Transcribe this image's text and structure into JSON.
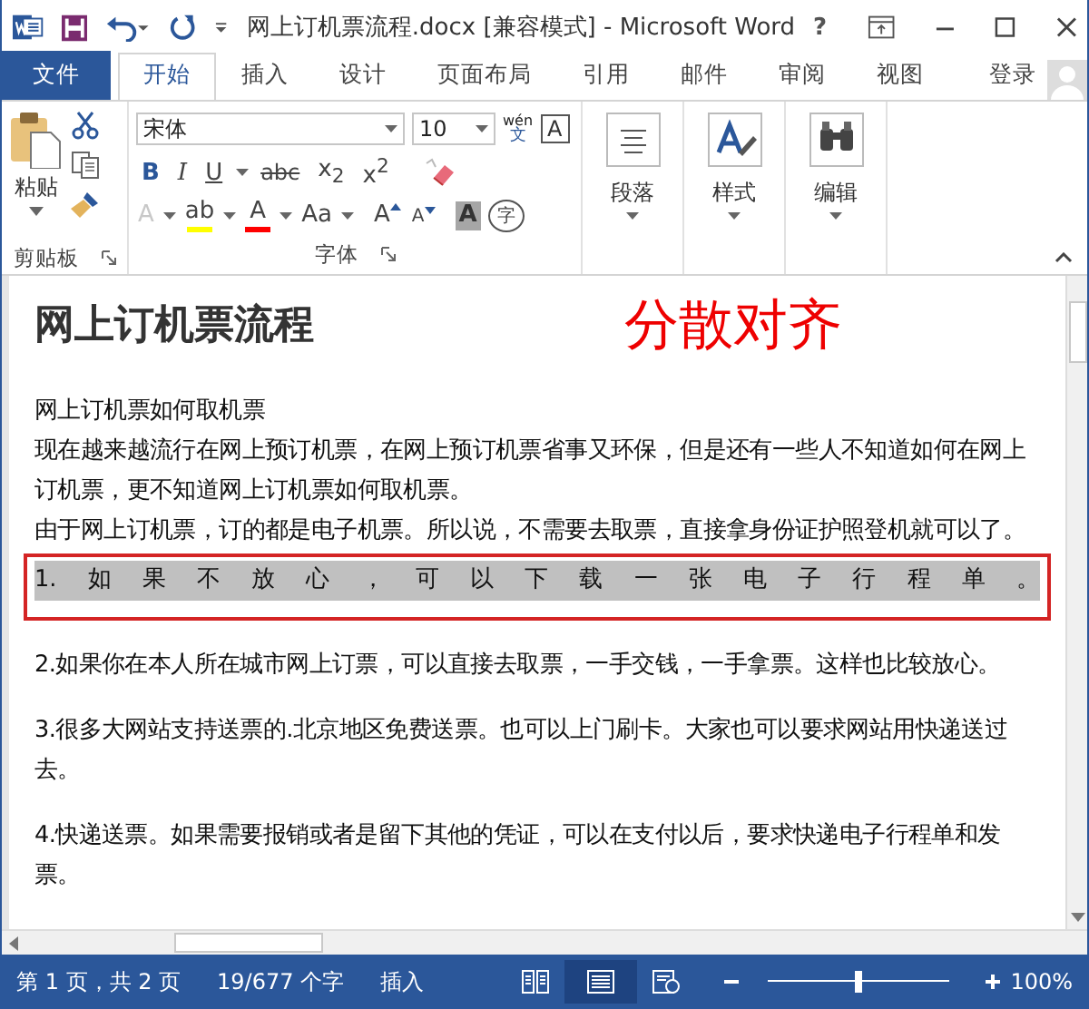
{
  "window": {
    "title": "网上订机票流程.docx [兼容模式] - Microsoft Word",
    "help": "?"
  },
  "tabs": [
    {
      "label": "文件",
      "kind": "file",
      "selected": false
    },
    {
      "label": "开始",
      "kind": "tab",
      "selected": true
    },
    {
      "label": "插入",
      "kind": "tab",
      "selected": false
    },
    {
      "label": "设计",
      "kind": "tab",
      "selected": false
    },
    {
      "label": "页面布局",
      "kind": "tab",
      "selected": false
    },
    {
      "label": "引用",
      "kind": "tab",
      "selected": false
    },
    {
      "label": "邮件",
      "kind": "tab",
      "selected": false
    },
    {
      "label": "审阅",
      "kind": "tab",
      "selected": false
    },
    {
      "label": "视图",
      "kind": "tab",
      "selected": false
    }
  ],
  "account": "登录",
  "ribbon": {
    "clipboard": {
      "paste": "粘贴",
      "label": "剪贴板"
    },
    "font": {
      "name": "宋体",
      "size": "10",
      "phonetic_top": "wén",
      "phonetic_bottom": "文",
      "border_glyph": "A",
      "label": "字体",
      "row2": [
        {
          "kind": "bold",
          "glyph": "B"
        },
        {
          "kind": "italic",
          "glyph": "I"
        },
        {
          "kind": "underline",
          "glyph": "U"
        },
        {
          "kind": "strike",
          "glyph": "abc"
        },
        {
          "kind": "sub",
          "glyph": "x$_{2}$"
        },
        {
          "kind": "super",
          "glyph": "x$^{2}$"
        }
      ],
      "row3": [
        {
          "kind": "effect",
          "glyph": "A"
        },
        {
          "kind": "highlight",
          "glyph": "ab",
          "color": "#ffff00"
        },
        {
          "kind": "color",
          "glyph": "A",
          "color": "#ff0000"
        },
        {
          "kind": "case",
          "glyph": "Aa"
        },
        {
          "kind": "grow",
          "glyph": "A"
        },
        {
          "kind": "shrink",
          "glyph": "A"
        },
        {
          "kind": "shade",
          "glyph": "A"
        },
        {
          "kind": "enclose",
          "glyph": "字"
        }
      ]
    },
    "big_buttons": [
      {
        "kind": "paragraph",
        "label": "段落"
      },
      {
        "kind": "styles",
        "label": "样式"
      },
      {
        "kind": "editing",
        "label": "编辑"
      }
    ]
  },
  "document": {
    "title": "网上订机票流程",
    "annotation": "分散对齐",
    "paragraphs": [
      {
        "kind": "spaced",
        "text": "网上订机票如何取机票"
      },
      {
        "kind": "plain",
        "text": "现在越来越流行在网上预订机票，在网上预订机票省事又环保，但是还有一些人不知道如何在网上订机票，更不知道网上订机票如何取机票。"
      },
      {
        "kind": "plain",
        "text": "由于网上订机票，订的都是电子机票。所以说，不需要去取票，直接拿身份证护照登机就可以了。"
      },
      {
        "kind": "distributed",
        "text": "1.如果不放心，可以下载一张电子行程单。",
        "highlighted": true
      },
      {
        "kind": "spaced",
        "text": "2.如果你在本人所在城市网上订票，可以直接去取票，一手交钱，一手拿票。这样也比较放心。"
      },
      {
        "kind": "spaced",
        "text": "3.很多大网站支持送票的.北京地区免费送票。也可以上门刷卡。大家也可以要求网站用快递送过去。"
      },
      {
        "kind": "spaced",
        "text": "4.快递送票。如果需要报销或者是留下其他的凭证，可以在支付以后，要求快递电子行程单和发票。"
      }
    ]
  },
  "status_bar": {
    "page": "第 1 页，共 2 页",
    "words": "19/677 个字",
    "mode": "插入",
    "views": [
      {
        "kind": "read",
        "selected": false
      },
      {
        "kind": "print",
        "selected": true
      },
      {
        "kind": "web",
        "selected": false
      }
    ],
    "zoom_slider": {
      "level": 0.5
    },
    "zoom": "100%"
  }
}
